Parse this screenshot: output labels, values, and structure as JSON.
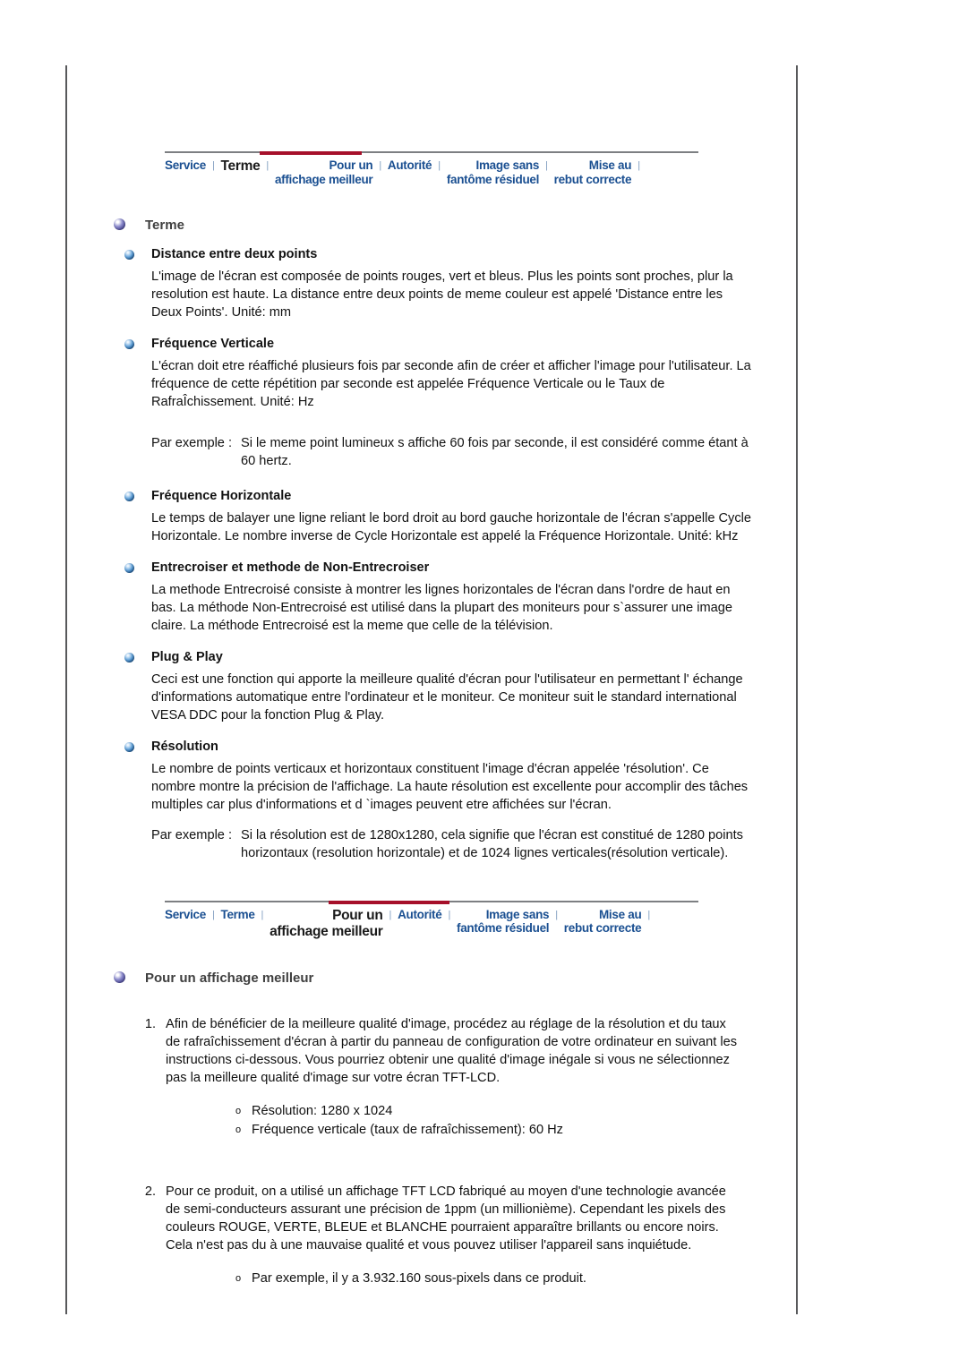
{
  "colors": {
    "nav_link": "#1a4f91",
    "nav_active": "#1a1a1a",
    "nav_accent_red": "#a6102a",
    "frame_rule": "#58595b",
    "major_heading": "#3f3f3f",
    "body_text": "#111111"
  },
  "nav_top": {
    "active": "Terme",
    "items": [
      {
        "label": "Service",
        "lines": [
          "Service"
        ],
        "active": false
      },
      {
        "label": "Terme",
        "lines": [
          "Terme"
        ],
        "active": true
      },
      {
        "label": "Pour un affichage meilleur",
        "lines": [
          "Pour un",
          "affichage meilleur"
        ],
        "active": false
      },
      {
        "label": "Autorité",
        "lines": [
          "Autorité"
        ],
        "active": false
      },
      {
        "label": "Image sans fantôme résiduel",
        "lines": [
          "Image sans",
          "fantôme résiduel"
        ],
        "active": false
      },
      {
        "label": "Mise au rebut correcte",
        "lines": [
          "Mise au",
          "rebut correcte"
        ],
        "active": false
      }
    ],
    "separator": "|"
  },
  "nav_bottom": {
    "active": "Pour un affichage meilleur",
    "items": [
      {
        "label": "Service",
        "lines": [
          "Service"
        ],
        "active": false
      },
      {
        "label": "Terme",
        "lines": [
          "Terme"
        ],
        "active": false
      },
      {
        "label": "Pour un affichage meilleur",
        "lines": [
          "Pour un",
          "affichage meilleur"
        ],
        "active": true
      },
      {
        "label": "Autorité",
        "lines": [
          "Autorité"
        ],
        "active": false
      },
      {
        "label": "Image sans fantôme résiduel",
        "lines": [
          "Image sans",
          "fantôme résiduel"
        ],
        "active": false
      },
      {
        "label": "Mise au rebut correcte",
        "lines": [
          "Mise au",
          "rebut correcte"
        ],
        "active": false
      }
    ],
    "separator": "|"
  },
  "terme": {
    "title": "Terme",
    "sections": {
      "distance": {
        "heading": "Distance entre deux points",
        "body": "L'image de l'écran est composée de points rouges, vert et bleus. Plus les points sont proches, plur la resolution est haute. La distance entre deux points de meme couleur est appelé 'Distance entre les Deux Points'. Unité: mm"
      },
      "freq_verticale": {
        "heading": "Fréquence Verticale",
        "body": "L'écran doit etre réaffiché plusieurs fois par seconde afin de créer et afficher l'image pour l'utilisateur. La fréquence de cette répétition par seconde est appelée Fréquence Verticale ou le Taux de RafraÎchissement. Unité: Hz",
        "example_label": "Par exemple :",
        "example_body": "Si le meme point lumineux s affiche 60 fois par seconde, il est considéré comme étant à 60 hertz."
      },
      "freq_horizontale": {
        "heading": "Fréquence Horizontale",
        "body": "Le temps de balayer une ligne reliant le bord droit au bord gauche horizontale de l'écran s'appelle Cycle Horizontale. Le nombre inverse de Cycle Horizontale est appelé la Fréquence Horizontale. Unité: kHz"
      },
      "entrecroiser": {
        "heading": "Entrecroiser et methode de Non-Entrecroiser",
        "body": "La methode Entrecroisé consiste à montrer les lignes horizontales de l'écran dans l'ordre de haut en bas. La méthode Non-Entrecroisé est utilisé dans la plupart des moniteurs pour s`assurer une image claire. La méthode Entrecroisé est la meme que celle de la télévision."
      },
      "plug_play": {
        "heading": "Plug & Play",
        "body": "Ceci est une fonction qui apporte la meilleure qualité d'écran pour l'utilisateur en permettant l' échange d'informations automatique entre l'ordinateur et le moniteur. Ce moniteur suit le standard international VESA DDC pour la fonction Plug & Play."
      },
      "resolution": {
        "heading": "Résolution",
        "body": "Le nombre de points verticaux et horizontaux constituent l'image d'écran appelée 'résolution'. Ce nombre montre la précision de l'affichage. La haute résolution est excellente pour accomplir des tâches multiples car plus d'informations et d `images peuvent etre affichées sur l'écran.",
        "example_label": "Par exemple :",
        "example_body": "Si la résolution est de 1280x1280, cela signifie que l'écran est constitué de 1280 points horizontaux (resolution horizontale) et de 1024 lignes verticales(résolution verticale)."
      }
    }
  },
  "affichage": {
    "title": "Pour un affichage meilleur",
    "items": [
      {
        "number": "1.",
        "text": "Afin de bénéficier de la meilleure qualité d'image, procédez au réglage de la résolution et du taux de rafraîchissement d'écran à partir du panneau de configuration de votre ordinateur en suivant les instructions ci-dessous. Vous pourriez obtenir une qualité d'image inégale si vous ne sélectionnez pas la meilleure qualité d'image sur votre écran TFT-LCD.",
        "sub": [
          "Résolution: 1280 x 1024",
          "Fréquence verticale (taux de rafraîchissement): 60 Hz"
        ]
      },
      {
        "number": "2.",
        "text": "Pour ce produit, on a utilisé un affichage TFT LCD fabriqué au moyen d'une technologie avancée de semi-conducteurs assurant une précision de 1ppm (un millionième). Cependant les pixels des couleurs ROUGE, VERTE, BLEUE et BLANCHE pourraient apparaître brillants ou encore noirs. Cela n'est pas du à une mauvaise qualité et vous pouvez utiliser l'appareil sans inquiétude.",
        "sub": [
          "Par exemple, il y a 3.932.160 sous-pixels dans ce produit."
        ]
      }
    ],
    "sub_bullet": "o"
  }
}
